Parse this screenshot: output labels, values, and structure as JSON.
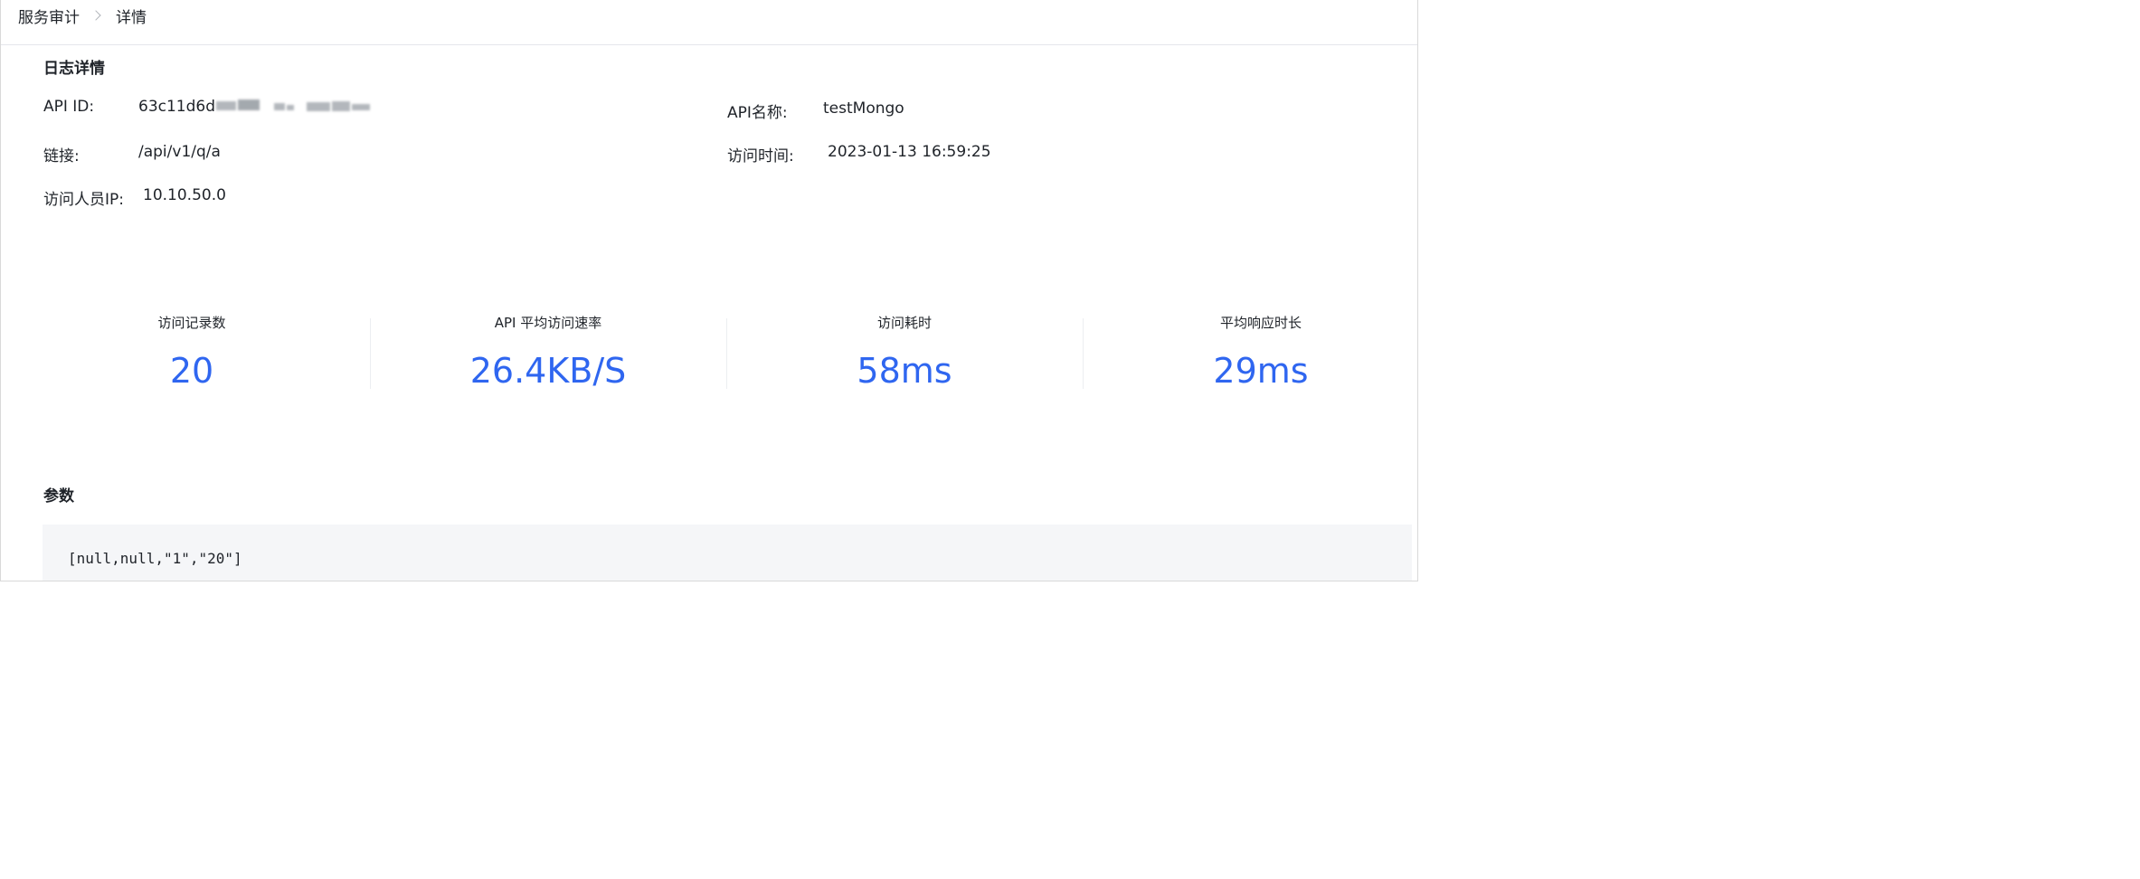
{
  "breadcrumb": {
    "parent": "服务审计",
    "current": "详情"
  },
  "log_detail": {
    "title": "日志详情",
    "api_id_label": "API ID:",
    "api_id_value": "63c11d6d",
    "api_id_redacted": true,
    "api_name_label": "API名称:",
    "api_name_value": "testMongo",
    "link_label": "链接:",
    "link_value": "/api/v1/q/a",
    "access_time_label": "访问时间:",
    "access_time_value": "2023-01-13 16:59:25",
    "visitor_ip_label": "访问人员IP:",
    "visitor_ip_value": "10.10.50.0"
  },
  "stats": [
    {
      "label": "访问记录数",
      "value": "20"
    },
    {
      "label": "API 平均访问速率",
      "value": "26.4KB/S"
    },
    {
      "label": "访问耗时",
      "value": "58ms"
    },
    {
      "label": "平均响应时长",
      "value": "29ms"
    }
  ],
  "params": {
    "title": "参数",
    "code": "[null,null,\"1\",\"20\"]"
  },
  "colors": {
    "accent": "#2f66f0",
    "text": "#1f2329",
    "code_background": "#f5f6f8"
  }
}
